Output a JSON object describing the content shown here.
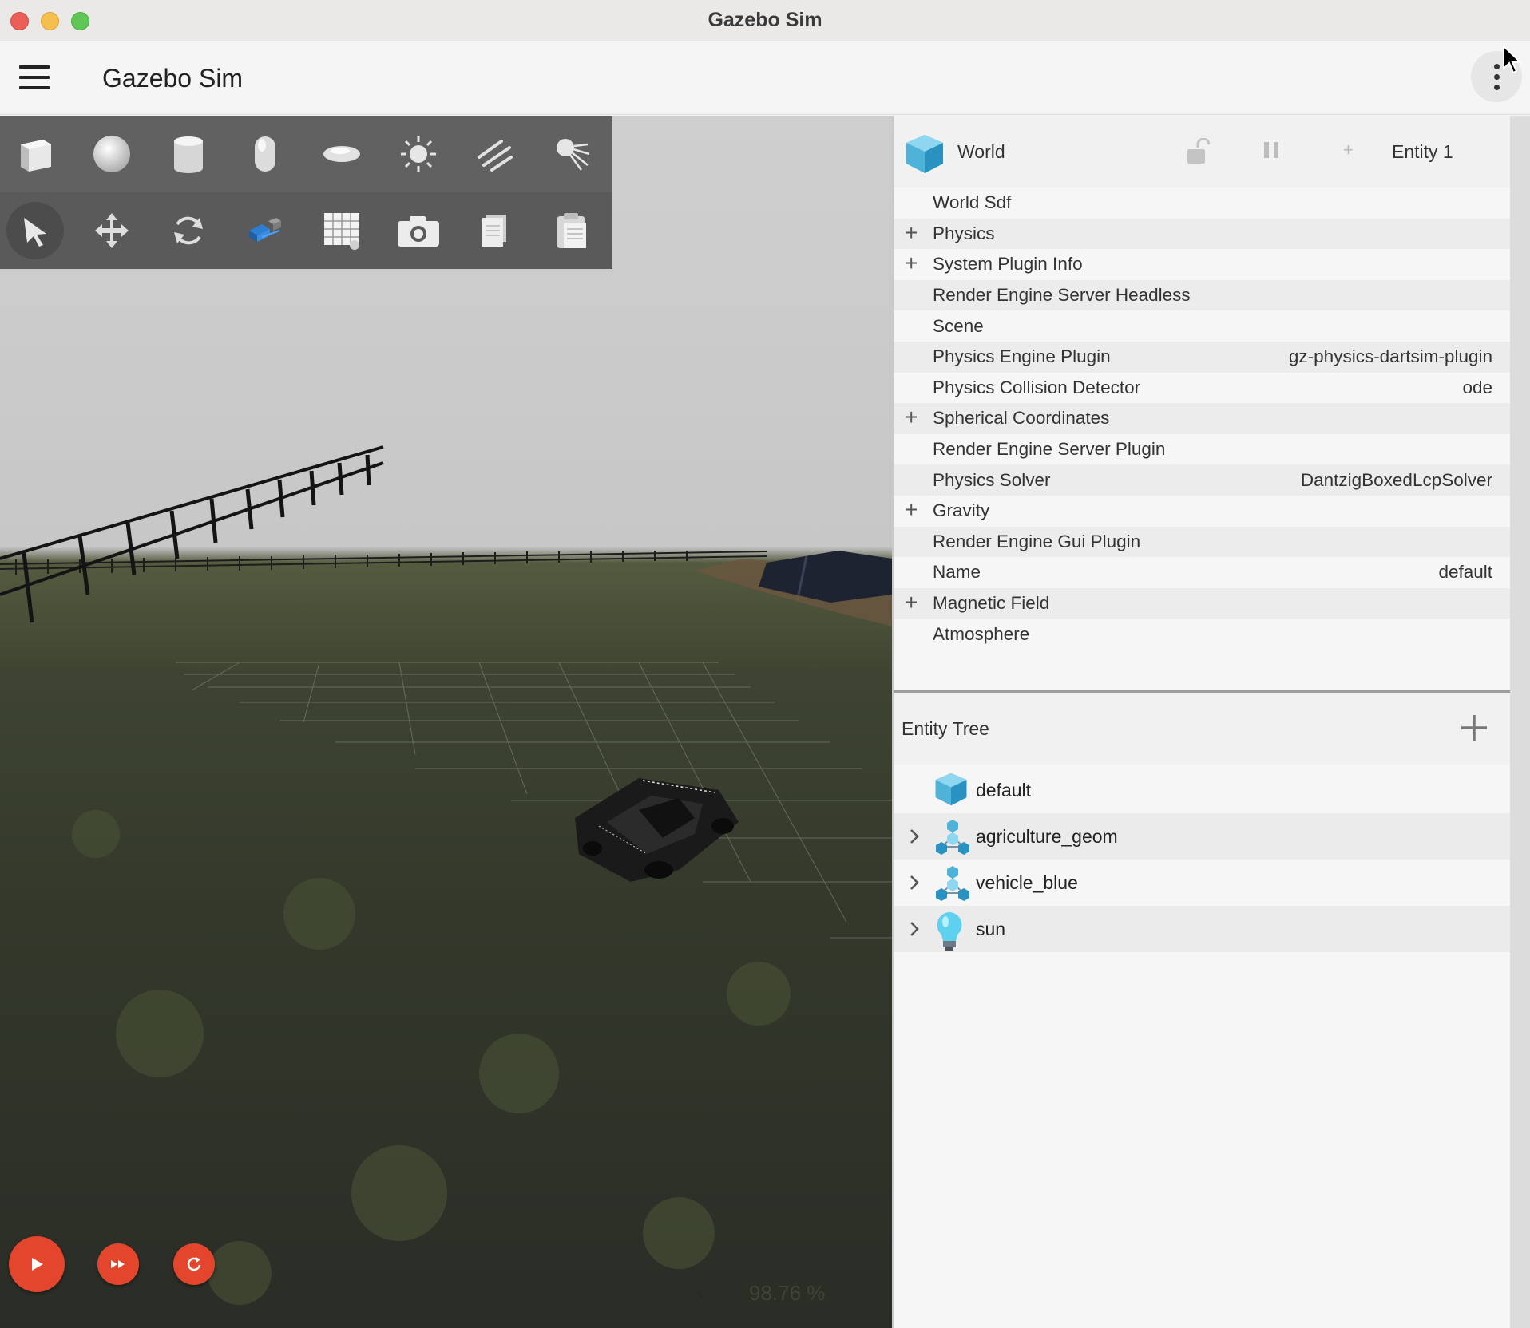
{
  "window": {
    "title": "Gazebo Sim"
  },
  "appbar": {
    "title": "Gazebo Sim"
  },
  "toolbar": {
    "row1": [
      "box-icon",
      "sphere-icon",
      "cylinder-icon",
      "capsule-icon",
      "ellipsoid-icon",
      "directional-light-icon",
      "point-light-icon",
      "spot-light-icon"
    ],
    "row2": [
      "select-icon",
      "translate-icon",
      "rotate-icon",
      "transform-snap-icon",
      "grid-icon",
      "screenshot-icon",
      "copy-icon",
      "paste-icon"
    ]
  },
  "playback": {
    "rtf": "98.76 %"
  },
  "component_inspector": {
    "title": "World",
    "entity": "Entity 1",
    "rows": [
      {
        "label": "World Sdf",
        "value": "",
        "expandable": false
      },
      {
        "label": "Physics",
        "value": "",
        "expandable": true
      },
      {
        "label": "System Plugin Info",
        "value": "",
        "expandable": true
      },
      {
        "label": "Render Engine Server Headless",
        "value": "",
        "expandable": false
      },
      {
        "label": "Scene",
        "value": "",
        "expandable": false
      },
      {
        "label": "Physics Engine Plugin",
        "value": "gz-physics-dartsim-plugin",
        "expandable": false
      },
      {
        "label": "Physics Collision Detector",
        "value": "ode",
        "expandable": false
      },
      {
        "label": "Spherical Coordinates",
        "value": "",
        "expandable": true
      },
      {
        "label": "Render Engine Server Plugin",
        "value": "",
        "expandable": false
      },
      {
        "label": "Physics Solver",
        "value": "DantzigBoxedLcpSolver",
        "expandable": false
      },
      {
        "label": "Gravity",
        "value": "",
        "expandable": true
      },
      {
        "label": "Render Engine Gui Plugin",
        "value": "",
        "expandable": false
      },
      {
        "label": "Name",
        "value": "default",
        "expandable": false
      },
      {
        "label": "Magnetic Field",
        "value": "",
        "expandable": true
      },
      {
        "label": "Atmosphere",
        "value": "",
        "expandable": false
      }
    ]
  },
  "entity_tree": {
    "title": "Entity Tree",
    "items": [
      {
        "label": "default",
        "icon": "world-cube-icon",
        "expandable": false
      },
      {
        "label": "agriculture_geom",
        "icon": "model-icon",
        "expandable": true
      },
      {
        "label": "vehicle_blue",
        "icon": "model-icon",
        "expandable": true
      },
      {
        "label": "sun",
        "icon": "light-bulb-icon",
        "expandable": true
      }
    ]
  },
  "colors": {
    "accent": "#e3462c",
    "toolbar": "#616161",
    "cube": "#4fb3d9"
  }
}
